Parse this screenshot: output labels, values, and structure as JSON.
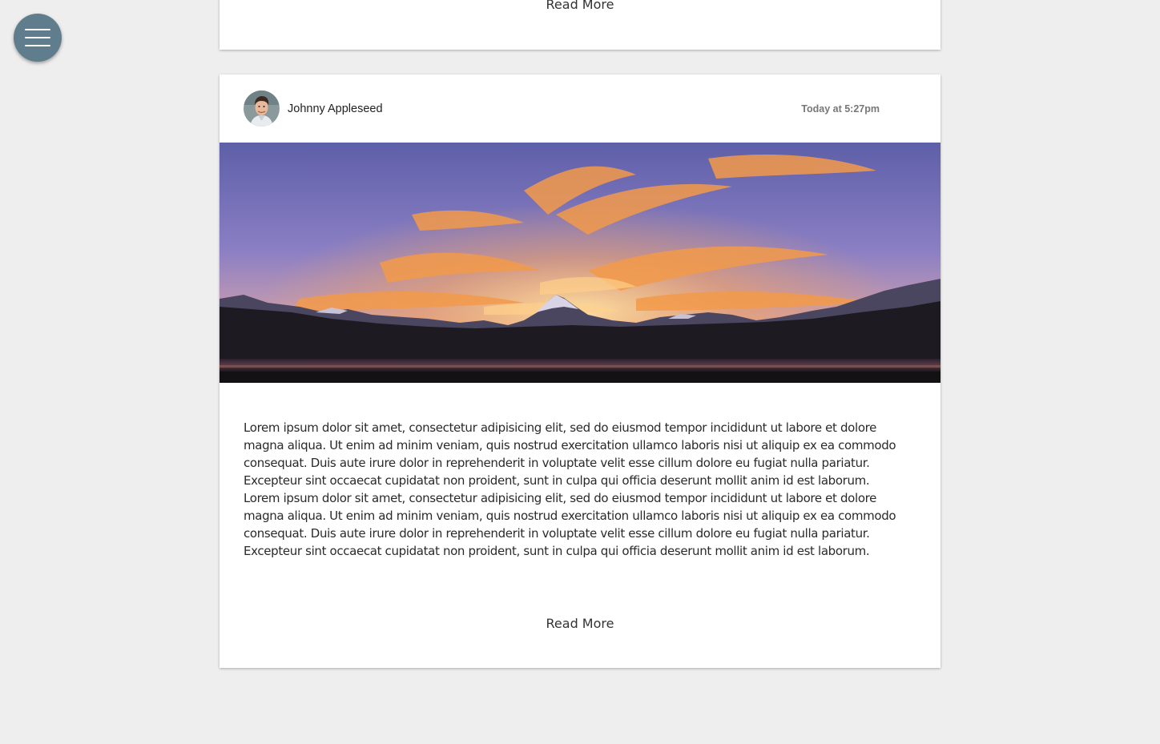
{
  "menu": {
    "icon": "hamburger-menu-icon",
    "color": "#5f7d8c"
  },
  "previous_post": {
    "read_more_label": "Read More"
  },
  "post": {
    "author": {
      "name": "Johnny Appleseed",
      "avatar": "author-avatar-photo"
    },
    "timestamp": "Today at 5:27pm",
    "image": "mountain-sunset-photo",
    "paragraphs": [
      "Lorem ipsum dolor sit amet, consectetur adipisicing elit, sed do eiusmod tempor incididunt ut labore et dolore magna aliqua. Ut enim ad minim veniam, quis nostrud exercitation ullamco laboris nisi ut aliquip ex ea commodo consequat. Duis aute irure dolor in reprehenderit in voluptate velit esse cillum dolore eu fugiat nulla pariatur. Excepteur sint occaecat cupidatat non proident, sunt in culpa qui officia deserunt mollit anim id est laborum.",
      "Lorem ipsum dolor sit amet, consectetur adipisicing elit, sed do eiusmod tempor incididunt ut labore et dolore magna aliqua. Ut enim ad minim veniam, quis nostrud exercitation ullamco laboris nisi ut aliquip ex ea commodo consequat. Duis aute irure dolor in reprehenderit in voluptate velit esse cillum dolore eu fugiat nulla pariatur. Excepteur sint occaecat cupidatat non proident, sunt in culpa qui officia deserunt mollit anim id est laborum."
    ],
    "read_more_label": "Read More"
  }
}
